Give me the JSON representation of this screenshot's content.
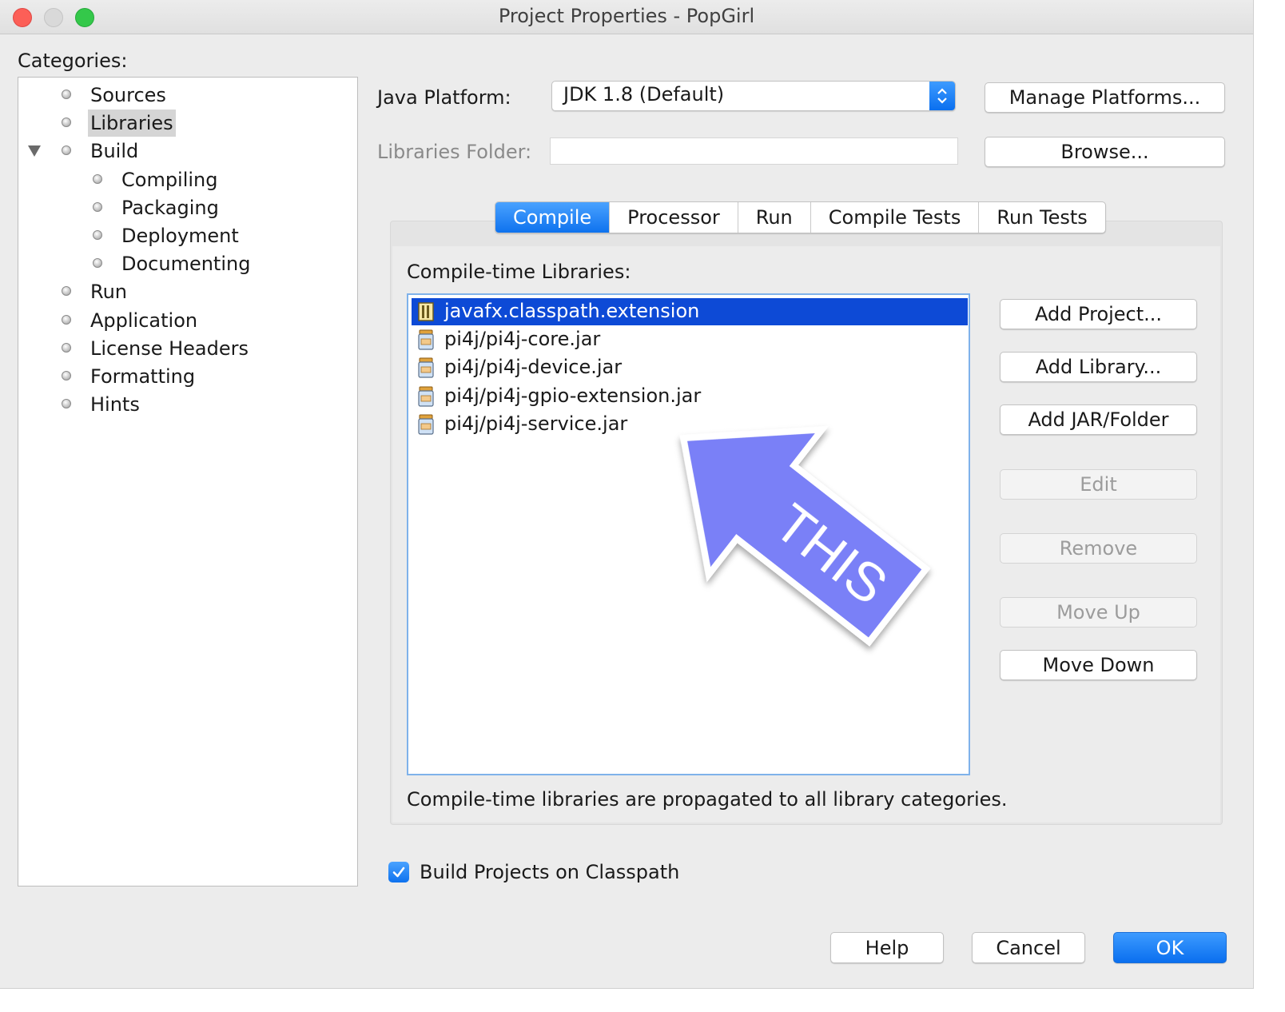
{
  "window": {
    "title": "Project Properties - PopGirl"
  },
  "categories": {
    "label": "Categories:",
    "items": [
      {
        "label": "Sources",
        "level": 0,
        "selected": false
      },
      {
        "label": "Libraries",
        "level": 0,
        "selected": true
      },
      {
        "label": "Build",
        "level": 0,
        "selected": false,
        "expanded": true
      },
      {
        "label": "Compiling",
        "level": 1,
        "selected": false
      },
      {
        "label": "Packaging",
        "level": 1,
        "selected": false
      },
      {
        "label": "Deployment",
        "level": 1,
        "selected": false
      },
      {
        "label": "Documenting",
        "level": 1,
        "selected": false
      },
      {
        "label": "Run",
        "level": 0,
        "selected": false
      },
      {
        "label": "Application",
        "level": 0,
        "selected": false
      },
      {
        "label": "License Headers",
        "level": 0,
        "selected": false
      },
      {
        "label": "Formatting",
        "level": 0,
        "selected": false
      },
      {
        "label": "Hints",
        "level": 0,
        "selected": false
      }
    ]
  },
  "platform": {
    "label": "Java Platform:",
    "value": "JDK 1.8 (Default)",
    "manage_button": "Manage Platforms..."
  },
  "libraries_folder": {
    "label": "Libraries Folder:",
    "value": "",
    "browse_button": "Browse..."
  },
  "tabs": [
    {
      "label": "Compile",
      "active": true
    },
    {
      "label": "Processor",
      "active": false
    },
    {
      "label": "Run",
      "active": false
    },
    {
      "label": "Compile Tests",
      "active": false
    },
    {
      "label": "Run Tests",
      "active": false
    }
  ],
  "compile": {
    "list_label": "Compile-time Libraries:",
    "items": [
      {
        "label": "javafx.classpath.extension",
        "selected": true,
        "icon": "library-icon"
      },
      {
        "label": "pi4j/pi4j-core.jar",
        "selected": false,
        "icon": "jar-icon"
      },
      {
        "label": "pi4j/pi4j-device.jar",
        "selected": false,
        "icon": "jar-icon"
      },
      {
        "label": "pi4j/pi4j-gpio-extension.jar",
        "selected": false,
        "icon": "jar-icon"
      },
      {
        "label": "pi4j/pi4j-service.jar",
        "selected": false,
        "icon": "jar-icon"
      }
    ],
    "buttons": {
      "add_project": "Add Project...",
      "add_library": "Add Library...",
      "add_jar": "Add JAR/Folder",
      "edit": "Edit",
      "remove": "Remove",
      "move_up": "Move Up",
      "move_down": "Move Down"
    },
    "note": "Compile-time libraries are propagated to all library categories."
  },
  "build_on_classpath": {
    "label": "Build Projects on Classpath",
    "checked": true
  },
  "annotation": {
    "text": "THIS",
    "color": "#7a80f7"
  },
  "footer": {
    "help": "Help",
    "cancel": "Cancel",
    "ok": "OK"
  }
}
